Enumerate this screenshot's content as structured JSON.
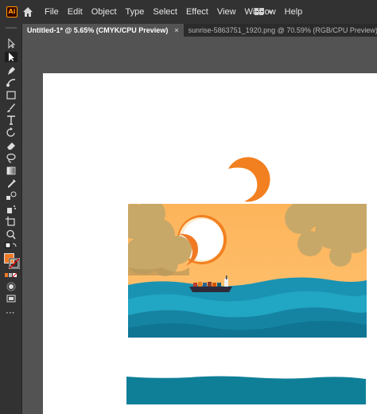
{
  "app": {
    "logo_text": "Ai"
  },
  "menu": [
    "File",
    "Edit",
    "Object",
    "Type",
    "Select",
    "Effect",
    "View",
    "Window",
    "Help"
  ],
  "tabs": [
    {
      "label": "Untitled-1* @ 5.65% (CMYK/CPU Preview)",
      "close": "×"
    },
    {
      "label": "sunrise-5863751_1920.png @ 70.59% (RGB/CPU Preview)",
      "close": "×"
    }
  ],
  "tools": [
    "selection-tool-icon",
    "direct-selection-tool-icon",
    "pen-tool-icon",
    "curvature-tool-icon",
    "rectangle-tool-icon",
    "paintbrush-tool-icon",
    "type-tool-icon",
    "rotate-tool-icon",
    "eraser-tool-icon",
    "lasso-tool-icon",
    "gradient-tool-icon",
    "eyedropper-tool-icon",
    "blend-tool-icon",
    "symbol-sprayer-tool-icon",
    "artboard-tool-icon",
    "zoom-tool-icon"
  ],
  "colors": {
    "fill": "#f07a24",
    "sun": "#f28020",
    "sky": "#fdb95c",
    "sea_dark": "#0f7f98",
    "sea_light": "#21a6c4",
    "cloud": "#c8a868"
  },
  "more_tools_label": "···"
}
